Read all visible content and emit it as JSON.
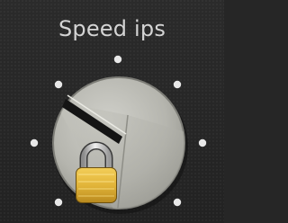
{
  "control": {
    "label": "Speed ips",
    "locked": true
  },
  "icons": {
    "lock": "lock-icon"
  },
  "colors": {
    "background": "#262626",
    "label": "#d4d4d4",
    "tick": "#e8e8e8",
    "knob": "#b7b7b0",
    "lock_body": "#e2b53a",
    "lock_shackle": "#c9c9c9"
  }
}
